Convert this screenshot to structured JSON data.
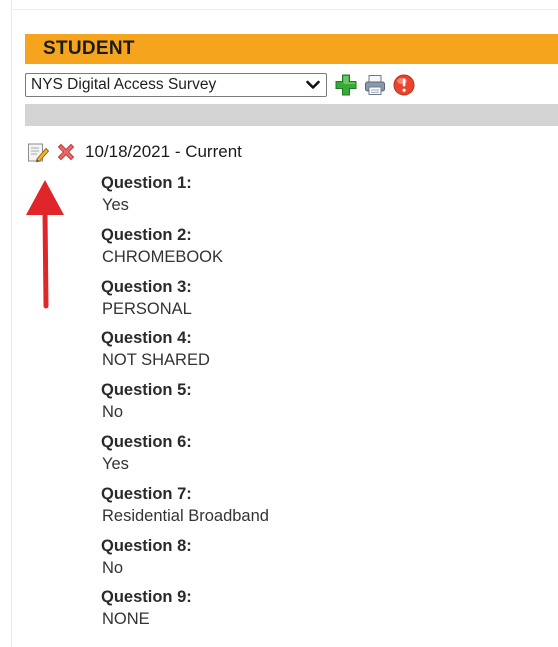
{
  "header": {
    "title": "STUDENT"
  },
  "toolbar": {
    "survey_select_value": "NYS Digital Access Survey",
    "icons": [
      "add-icon",
      "printer-icon",
      "help-icon"
    ]
  },
  "entry": {
    "date": "10/18/2021",
    "separator": " - ",
    "status": "Current"
  },
  "questions": [
    {
      "label": "Question 1:",
      "answer": "Yes"
    },
    {
      "label": "Question 2:",
      "answer": "CHROMEBOOK"
    },
    {
      "label": "Question 3:",
      "answer": "PERSONAL"
    },
    {
      "label": "Question 4:",
      "answer": "NOT SHARED"
    },
    {
      "label": "Question 5:",
      "answer": "No"
    },
    {
      "label": "Question 6:",
      "answer": "Yes"
    },
    {
      "label": "Question 7:",
      "answer": "Residential Broadband"
    },
    {
      "label": "Question 8:",
      "answer": "No"
    },
    {
      "label": "Question 9:",
      "answer": "NONE"
    }
  ],
  "colors": {
    "header_bg": "#f5a51d",
    "strip_bg": "#d4d4d4",
    "arrow": "#e0262a",
    "add_icon": "#3aa83a",
    "help_icon": "#e8452c"
  }
}
